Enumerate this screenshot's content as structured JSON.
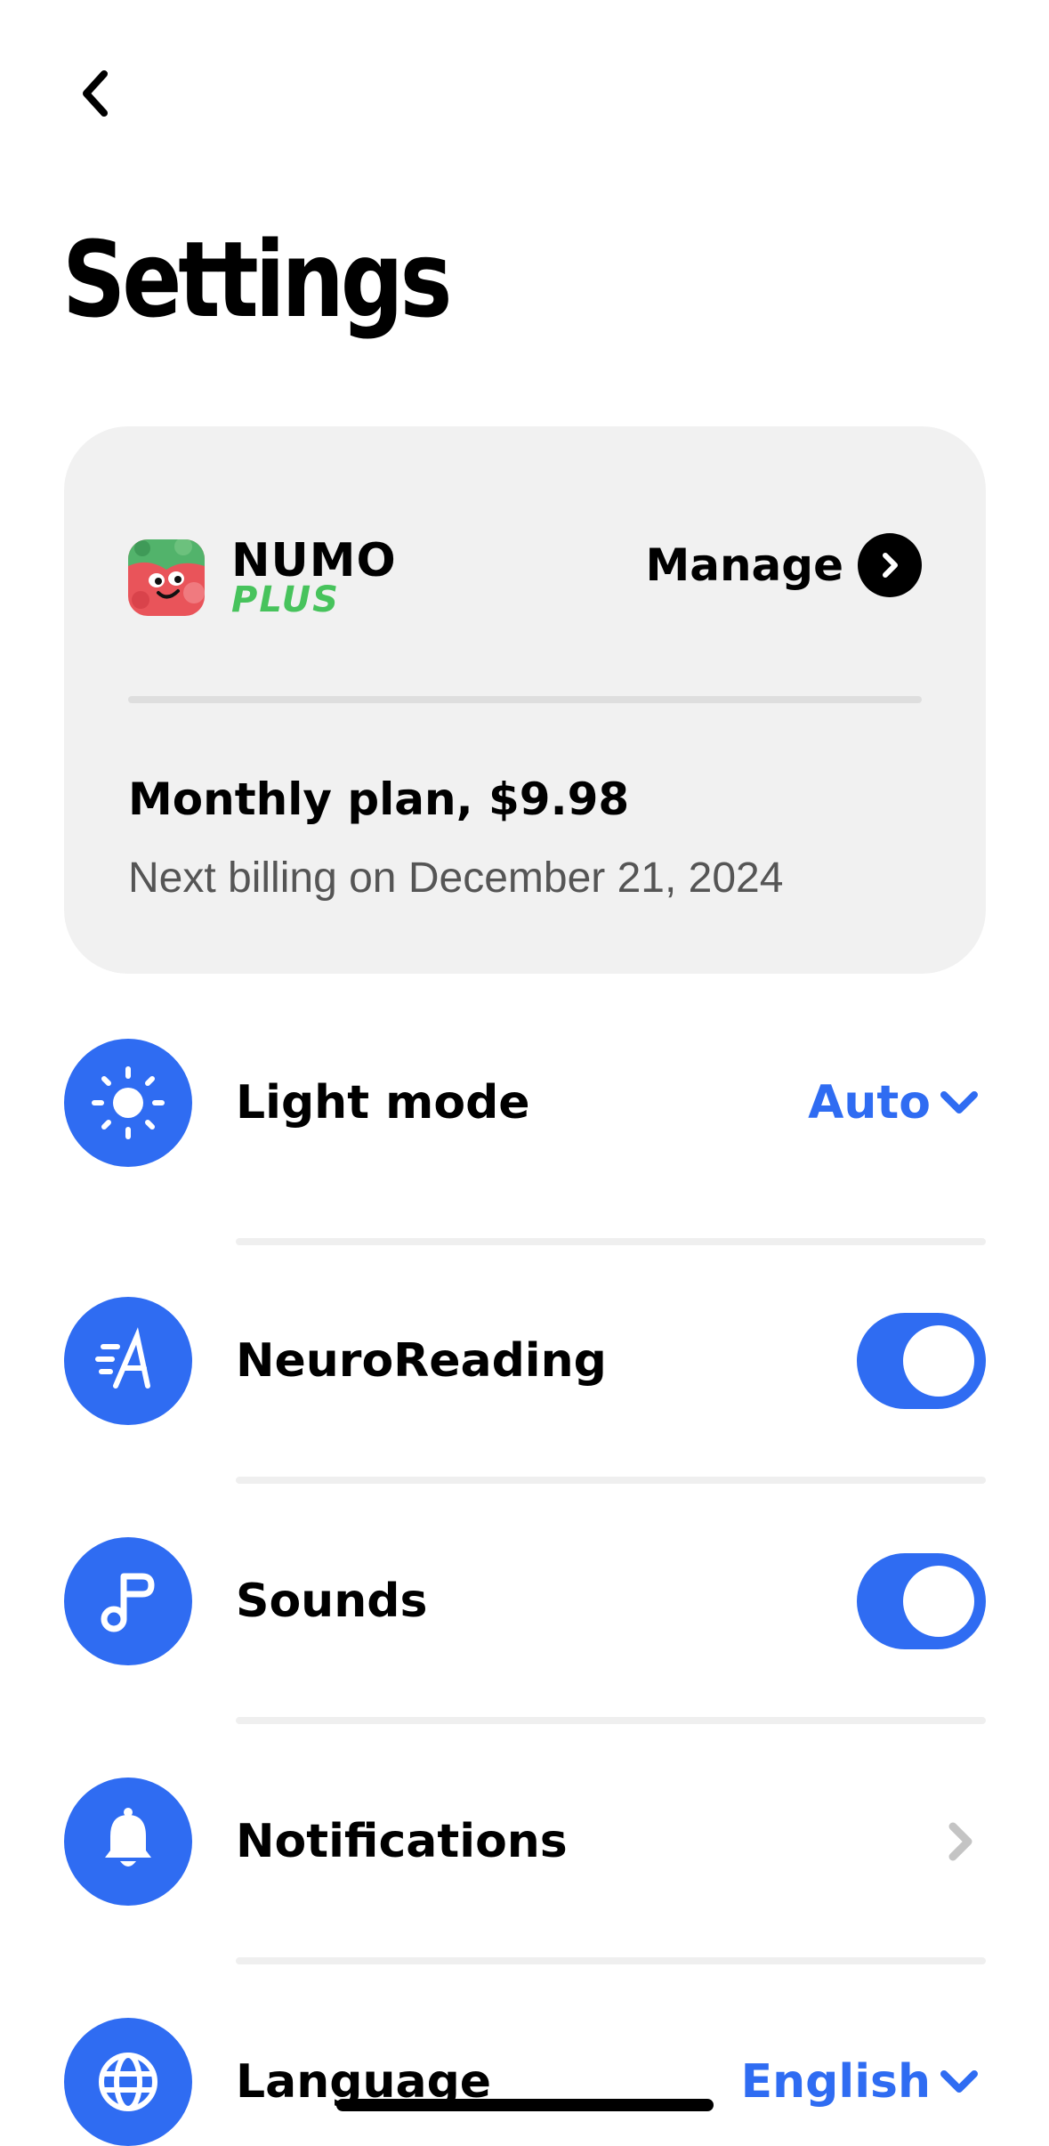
{
  "header": {
    "back_icon": "chevron-left-icon",
    "title": "Settings"
  },
  "subscription": {
    "logo": {
      "brand": "NUMO",
      "tier": "PLUS"
    },
    "manage_label": "Manage",
    "plan": "Monthly plan, $9.98",
    "billing": "Next billing on December 21, 2024"
  },
  "settings": [
    {
      "label": "Light mode",
      "icon": "sun-icon",
      "control": "dropdown",
      "value": "Auto"
    },
    {
      "label": "NeuroReading",
      "icon": "neuroreading-icon",
      "control": "toggle",
      "on": true
    },
    {
      "label": "Sounds",
      "icon": "music-note-icon",
      "control": "toggle",
      "on": true
    },
    {
      "label": "Notifications",
      "icon": "bell-icon",
      "control": "chevron"
    },
    {
      "label": "Language",
      "icon": "globe-icon",
      "control": "dropdown",
      "value": "English"
    }
  ],
  "colors": {
    "accent": "#2f6cf2",
    "card_bg": "#f1f1f1",
    "plus_green": "#47c35c",
    "chevron_gray": "#c4c4c4"
  }
}
